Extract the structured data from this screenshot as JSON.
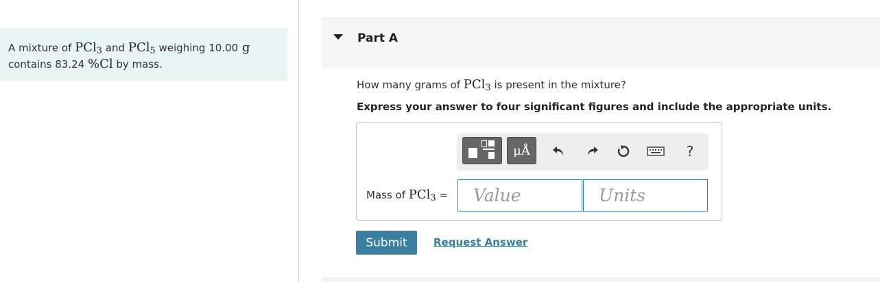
{
  "problem": {
    "line1_prefix": "A mixture of ",
    "f1": "PCl",
    "f1_sub": "3",
    "and": " and ",
    "f2": "PCl",
    "f2_sub": "5",
    "weighing": " weighing ",
    "mass": "10.00",
    "mass_unit": " g",
    "line2_prefix": "contains ",
    "percent_value": "83.24 ",
    "percent": "%",
    "element": "Cl",
    "line2_suffix": " by mass."
  },
  "part": {
    "title": "Part A"
  },
  "question": {
    "prefix": "How many grams of ",
    "formula": "PCl",
    "formula_sub": "3",
    "suffix": " is present in the mixture?"
  },
  "instruction": "Express your answer to four significant figures and include the appropriate units.",
  "toolbar": {
    "units_symbol": "μÅ",
    "help_symbol": "?"
  },
  "answer": {
    "label_prefix": "Mass of ",
    "label_formula": "PCl",
    "label_sub": "3",
    "equals": "=",
    "value_placeholder": "Value",
    "units_placeholder": "Units"
  },
  "actions": {
    "submit_label": "Submit",
    "request_answer_label": "Request Answer"
  },
  "colors": {
    "accent": "#3a7fa0",
    "problem_bg": "#e9f4f5",
    "toolbar_btn": "#666666"
  }
}
